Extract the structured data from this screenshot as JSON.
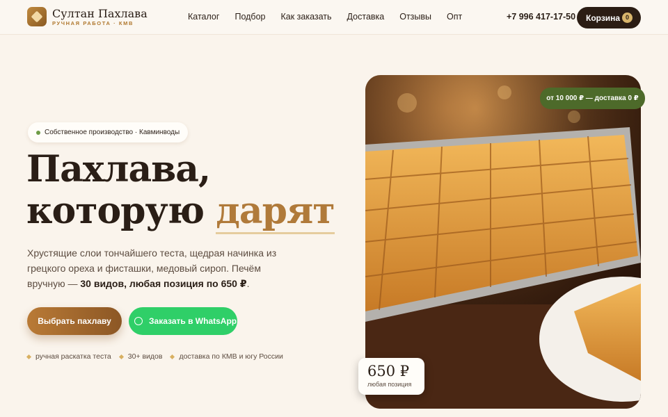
{
  "brand": {
    "title": "Султан Пахлава",
    "subtitle": "РУЧНАЯ РАБОТА · КМВ"
  },
  "nav": [
    "Каталог",
    "Подбор",
    "Как заказать",
    "Доставка",
    "Отзывы",
    "Опт"
  ],
  "phone": "+7 996 417-17-50",
  "cart": {
    "label": "Корзина",
    "count": "0"
  },
  "hero": {
    "badge": "Собственное производство · Кавминводы",
    "headline_line1": "Пахлава,",
    "headline_line2_prefix": "которую ",
    "headline_accent": "дарят",
    "lead_text": "Хрустящие слои тончайшего теста, щедрая начинка из грецкого ореха и фисташки, медовый сироп. Печём вручную — ",
    "lead_bold": "30 видов, любая позиция по 650 ₽",
    "lead_end": ".",
    "primary_button": "Выбрать пахлаву",
    "whatsapp_button": "Заказать в WhatsApp",
    "features": [
      "ручная раскатка теста",
      "30+ видов",
      "доставка по КМВ и югу России"
    ]
  },
  "image_overlay": {
    "delivery_pill": "от 10 000 ₽ — доставка 0 ₽",
    "price": "650 ₽",
    "price_label": "любая позиция"
  },
  "colors": {
    "accent": "#b07a3a",
    "dark": "#2b1d14",
    "whatsapp": "#2fcf68",
    "green": "#4d6a2a"
  },
  "icons": {
    "brand": "logo-diamond-icon",
    "whatsapp": "whatsapp-icon",
    "status": "green-dot-icon"
  }
}
